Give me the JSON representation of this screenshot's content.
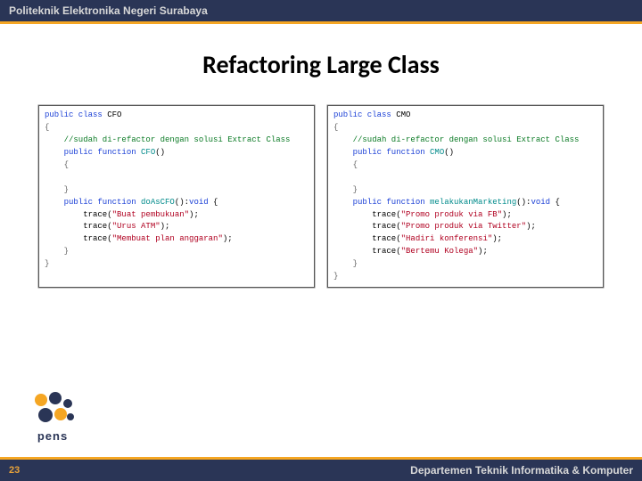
{
  "header": {
    "institution": "Politeknik Elektronika Negeri Surabaya"
  },
  "title": "Refactoring Large Class",
  "code_left": {
    "line1_kw": "public class",
    "line1_name": " CFO",
    "brace_open": "{",
    "comment": "    //sudah di-refactor dengan solusi Extract Class",
    "fn1_kw": "    public function ",
    "fn1_name": "CFO",
    "fn1_paren": "()",
    "fn1_open": "    {",
    "fn1_close": "    }",
    "fn2_kw": "    public function ",
    "fn2_name": "doAsCFO",
    "fn2_sig": "():",
    "fn2_ret": "void",
    "fn2_tail": " {",
    "t1a": "        trace(",
    "t1b": "\"Buat pembukuan\"",
    "t1c": ");",
    "t2a": "        trace(",
    "t2b": "\"Urus ATM\"",
    "t2c": ");",
    "t3a": "        trace(",
    "t3b": "\"Membuat plan anggaran\"",
    "t3c": ");",
    "fn2_close": "    }",
    "brace_close": "}"
  },
  "code_right": {
    "line1_kw": "public class",
    "line1_name": " CMO",
    "brace_open": "{",
    "comment": "    //sudah di-refactor dengan solusi Extract Class",
    "fn1_kw": "    public function ",
    "fn1_name": "CMO",
    "fn1_paren": "()",
    "fn1_open": "    {",
    "fn1_close": "    }",
    "fn2_kw": "    public function ",
    "fn2_name": "melakukanMarketing",
    "fn2_sig": "():",
    "fn2_ret": "void",
    "fn2_tail": " {",
    "t1a": "        trace(",
    "t1b": "\"Promo produk via FB\"",
    "t1c": ");",
    "t2a": "        trace(",
    "t2b": "\"Promo produk via Twitter\"",
    "t2c": ");",
    "t3a": "        trace(",
    "t3b": "\"Hadiri konferensi\"",
    "t3c": ");",
    "t4a": "        trace(",
    "t4b": "\"Bertemu Kolega\"",
    "t4c": ");",
    "fn2_close": "    }",
    "brace_close": "}"
  },
  "footer": {
    "page": "23",
    "department": "Departemen Teknik Informatika & Komputer"
  },
  "logo": {
    "text": "pens"
  }
}
